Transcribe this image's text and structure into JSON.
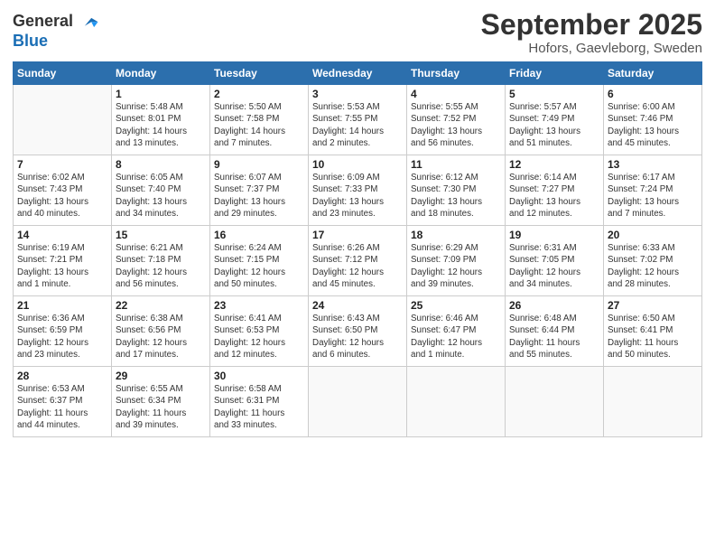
{
  "header": {
    "logo_general": "General",
    "logo_blue": "Blue",
    "month": "September 2025",
    "location": "Hofors, Gaevleborg, Sweden"
  },
  "weekdays": [
    "Sunday",
    "Monday",
    "Tuesday",
    "Wednesday",
    "Thursday",
    "Friday",
    "Saturday"
  ],
  "weeks": [
    [
      {
        "day": "",
        "info": ""
      },
      {
        "day": "1",
        "info": "Sunrise: 5:48 AM\nSunset: 8:01 PM\nDaylight: 14 hours\nand 13 minutes."
      },
      {
        "day": "2",
        "info": "Sunrise: 5:50 AM\nSunset: 7:58 PM\nDaylight: 14 hours\nand 7 minutes."
      },
      {
        "day": "3",
        "info": "Sunrise: 5:53 AM\nSunset: 7:55 PM\nDaylight: 14 hours\nand 2 minutes."
      },
      {
        "day": "4",
        "info": "Sunrise: 5:55 AM\nSunset: 7:52 PM\nDaylight: 13 hours\nand 56 minutes."
      },
      {
        "day": "5",
        "info": "Sunrise: 5:57 AM\nSunset: 7:49 PM\nDaylight: 13 hours\nand 51 minutes."
      },
      {
        "day": "6",
        "info": "Sunrise: 6:00 AM\nSunset: 7:46 PM\nDaylight: 13 hours\nand 45 minutes."
      }
    ],
    [
      {
        "day": "7",
        "info": "Sunrise: 6:02 AM\nSunset: 7:43 PM\nDaylight: 13 hours\nand 40 minutes."
      },
      {
        "day": "8",
        "info": "Sunrise: 6:05 AM\nSunset: 7:40 PM\nDaylight: 13 hours\nand 34 minutes."
      },
      {
        "day": "9",
        "info": "Sunrise: 6:07 AM\nSunset: 7:37 PM\nDaylight: 13 hours\nand 29 minutes."
      },
      {
        "day": "10",
        "info": "Sunrise: 6:09 AM\nSunset: 7:33 PM\nDaylight: 13 hours\nand 23 minutes."
      },
      {
        "day": "11",
        "info": "Sunrise: 6:12 AM\nSunset: 7:30 PM\nDaylight: 13 hours\nand 18 minutes."
      },
      {
        "day": "12",
        "info": "Sunrise: 6:14 AM\nSunset: 7:27 PM\nDaylight: 13 hours\nand 12 minutes."
      },
      {
        "day": "13",
        "info": "Sunrise: 6:17 AM\nSunset: 7:24 PM\nDaylight: 13 hours\nand 7 minutes."
      }
    ],
    [
      {
        "day": "14",
        "info": "Sunrise: 6:19 AM\nSunset: 7:21 PM\nDaylight: 13 hours\nand 1 minute."
      },
      {
        "day": "15",
        "info": "Sunrise: 6:21 AM\nSunset: 7:18 PM\nDaylight: 12 hours\nand 56 minutes."
      },
      {
        "day": "16",
        "info": "Sunrise: 6:24 AM\nSunset: 7:15 PM\nDaylight: 12 hours\nand 50 minutes."
      },
      {
        "day": "17",
        "info": "Sunrise: 6:26 AM\nSunset: 7:12 PM\nDaylight: 12 hours\nand 45 minutes."
      },
      {
        "day": "18",
        "info": "Sunrise: 6:29 AM\nSunset: 7:09 PM\nDaylight: 12 hours\nand 39 minutes."
      },
      {
        "day": "19",
        "info": "Sunrise: 6:31 AM\nSunset: 7:05 PM\nDaylight: 12 hours\nand 34 minutes."
      },
      {
        "day": "20",
        "info": "Sunrise: 6:33 AM\nSunset: 7:02 PM\nDaylight: 12 hours\nand 28 minutes."
      }
    ],
    [
      {
        "day": "21",
        "info": "Sunrise: 6:36 AM\nSunset: 6:59 PM\nDaylight: 12 hours\nand 23 minutes."
      },
      {
        "day": "22",
        "info": "Sunrise: 6:38 AM\nSunset: 6:56 PM\nDaylight: 12 hours\nand 17 minutes."
      },
      {
        "day": "23",
        "info": "Sunrise: 6:41 AM\nSunset: 6:53 PM\nDaylight: 12 hours\nand 12 minutes."
      },
      {
        "day": "24",
        "info": "Sunrise: 6:43 AM\nSunset: 6:50 PM\nDaylight: 12 hours\nand 6 minutes."
      },
      {
        "day": "25",
        "info": "Sunrise: 6:46 AM\nSunset: 6:47 PM\nDaylight: 12 hours\nand 1 minute."
      },
      {
        "day": "26",
        "info": "Sunrise: 6:48 AM\nSunset: 6:44 PM\nDaylight: 11 hours\nand 55 minutes."
      },
      {
        "day": "27",
        "info": "Sunrise: 6:50 AM\nSunset: 6:41 PM\nDaylight: 11 hours\nand 50 minutes."
      }
    ],
    [
      {
        "day": "28",
        "info": "Sunrise: 6:53 AM\nSunset: 6:37 PM\nDaylight: 11 hours\nand 44 minutes."
      },
      {
        "day": "29",
        "info": "Sunrise: 6:55 AM\nSunset: 6:34 PM\nDaylight: 11 hours\nand 39 minutes."
      },
      {
        "day": "30",
        "info": "Sunrise: 6:58 AM\nSunset: 6:31 PM\nDaylight: 11 hours\nand 33 minutes."
      },
      {
        "day": "",
        "info": ""
      },
      {
        "day": "",
        "info": ""
      },
      {
        "day": "",
        "info": ""
      },
      {
        "day": "",
        "info": ""
      }
    ]
  ]
}
